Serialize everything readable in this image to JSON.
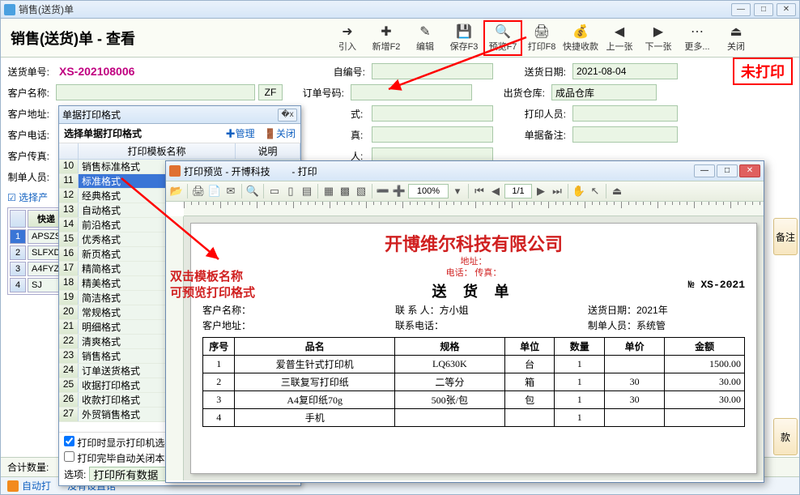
{
  "main": {
    "winTitle": "销售(送货)单",
    "pageTitle": "销售(送货)单 - 查看",
    "toolbar": [
      {
        "id": "import",
        "label": "引入",
        "icon": "➜"
      },
      {
        "id": "newf2",
        "label": "新增F2",
        "icon": "✚"
      },
      {
        "id": "edit",
        "label": "编辑",
        "icon": "✎"
      },
      {
        "id": "savef3",
        "label": "保存F3",
        "icon": "💾"
      },
      {
        "id": "previewf7",
        "label": "预览F7",
        "icon": "🔍",
        "hl": true
      },
      {
        "id": "printf8",
        "label": "打印F8",
        "icon": "🖨"
      },
      {
        "id": "quickpay",
        "label": "快捷收款",
        "icon": "💰"
      },
      {
        "id": "prev",
        "label": "上一张",
        "icon": "◀"
      },
      {
        "id": "next",
        "label": "下一张",
        "icon": "▶"
      },
      {
        "id": "more",
        "label": "更多...",
        "icon": "⋯"
      },
      {
        "id": "close",
        "label": "关闭",
        "icon": "⏏"
      }
    ],
    "labels": {
      "docNo": "送货单号:",
      "selfNo": "自编号:",
      "date": "送货日期:",
      "cust": "客户名称:",
      "orderNo": "订单号码:",
      "warehouse": "出货仓库:",
      "addr": "客户地址:",
      "printer": "打印人员:",
      "tel": "客户电话:",
      "maker": "单据备注:",
      "fax": "客户传真:",
      "makerP": "制单人员:",
      "fast": "快递",
      "selProd": "选择产",
      "total": "合计数量:",
      "auto": "自动打",
      "noset": "没有设置馆",
      "remark": "备注",
      "pay": "款"
    },
    "stamp": "未打印",
    "zf": "ZF",
    "values": {
      "docNo": "XS-202108006",
      "date": "2021-08-04",
      "warehouse": "成品仓库"
    },
    "gridRows": [
      {
        "n": "1",
        "code": "APSZS"
      },
      {
        "n": "2",
        "code": "SLFXD"
      },
      {
        "n": "3",
        "code": "A4FYZ"
      },
      {
        "n": "4",
        "code": "SJ"
      }
    ]
  },
  "fmt": {
    "title": "单据打印格式",
    "subtitle": "选择单据打印格式",
    "manage": "管理",
    "close": "关闭",
    "colTemplate": "打印模板名称",
    "colDesc": "说明",
    "list": [
      {
        "n": "10",
        "name": "销售标准格式"
      },
      {
        "n": "11",
        "name": "标准格式",
        "sel": true
      },
      {
        "n": "12",
        "name": "经典格式"
      },
      {
        "n": "13",
        "name": "自动格式"
      },
      {
        "n": "14",
        "name": "前沿格式"
      },
      {
        "n": "15",
        "name": "优秀格式"
      },
      {
        "n": "16",
        "name": "新页格式"
      },
      {
        "n": "17",
        "name": "精简格式"
      },
      {
        "n": "18",
        "name": "精美格式"
      },
      {
        "n": "19",
        "name": "简洁格式"
      },
      {
        "n": "20",
        "name": "常规格式"
      },
      {
        "n": "21",
        "name": "明细格式"
      },
      {
        "n": "22",
        "name": "清爽格式"
      },
      {
        "n": "23",
        "name": "销售格式"
      },
      {
        "n": "24",
        "name": "订单送货格式"
      },
      {
        "n": "25",
        "name": "收据打印格式"
      },
      {
        "n": "26",
        "name": "收款打印格式"
      },
      {
        "n": "27",
        "name": "外贸销售格式"
      }
    ],
    "chkShowPrinter": "打印时显示打印机选择",
    "chkAutoClose": "打印完毕自动关闭本",
    "optLabel": "选项:",
    "optValue": "打印所有数据"
  },
  "prv": {
    "title": "打印预览 - 开博科技",
    "title2": "- 打印",
    "zoom": "100%",
    "page": "1/1",
    "company": "开博维尔科技有限公司",
    "addr": "地址：",
    "teln": "电话：   传真：",
    "doct": "送 货 单",
    "docno": "№ XS-2021",
    "row1": {
      "a": "客户名称：",
      "b": "联 系 人：方小姐",
      "c": "送货日期：2021年"
    },
    "row2": {
      "a": "客户地址：",
      "b": "联系电话：",
      "c": "制单人员：系统管"
    },
    "cols": [
      "序号",
      "品名",
      "规格",
      "单位",
      "数量",
      "单价",
      "金额"
    ],
    "lines": [
      {
        "n": "1",
        "name": "爱普生针式打印机",
        "spec": "LQ630K",
        "unit": "台",
        "qty": "1",
        "price": "",
        "amt": "1500.00"
      },
      {
        "n": "2",
        "name": "三联复写打印纸",
        "spec": "二等分",
        "unit": "箱",
        "qty": "1",
        "price": "30",
        "amt": "30.00"
      },
      {
        "n": "3",
        "name": "A4复印纸70g",
        "spec": "500张/包",
        "unit": "包",
        "qty": "1",
        "price": "30",
        "amt": "30.00"
      },
      {
        "n": "4",
        "name": "手机",
        "spec": "",
        "unit": "",
        "qty": "1",
        "price": "",
        "amt": ""
      }
    ]
  },
  "annot": {
    "l1": "双击模板名称",
    "l2": "可预览打印格式"
  }
}
